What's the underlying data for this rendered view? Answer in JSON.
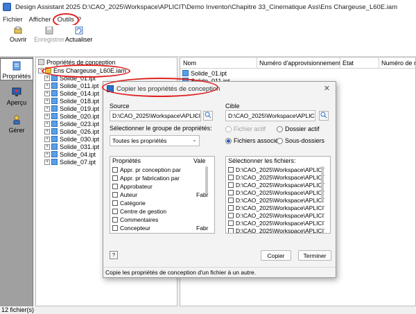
{
  "window": {
    "title": "Design Assistant 2025 D:\\CAO_2025\\Workspace\\APLICIT\\Demo Inventor\\Chapitre 33_Cinematique Ass\\Ens Chargeuse_L60E.iam"
  },
  "menu": {
    "file": "Fichier",
    "view": "Afficher",
    "tools": "Outils",
    "help": "?"
  },
  "toolbar": {
    "open": "Ouvrir",
    "save": "Enregistrer",
    "refresh": "Actualiser"
  },
  "nav": {
    "properties": "Propriétés",
    "preview": "Aperçu",
    "manage": "Gérer"
  },
  "tree": {
    "header": "Propriétés de conception",
    "root": "Ens Chargeuse_L60E.iam",
    "items": [
      "Solide_01.ipt",
      "Solide_011.ipt",
      "Solide_014.ipt",
      "Solide_018.ipt",
      "Solide_019.ipt",
      "Solide_020.ipt",
      "Solide_023.ipt",
      "Solide_026.ipt",
      "Solide_030.ipt",
      "Solide_031.ipt",
      "Solide_04.ipt",
      "Solide_07.ipt"
    ]
  },
  "list": {
    "columns": [
      "Nom",
      "Numéro d'approvisionnement",
      "Etat",
      "Numéro de ré"
    ],
    "rows": [
      "Solide_01.ipt",
      "Solide_011.ipt"
    ]
  },
  "status": {
    "text": "12 fichier(s)"
  },
  "dialog": {
    "title": "Copier les propriétés de conception",
    "close": "✕",
    "source_label": "Source",
    "source_path": "D:\\CAO_2025\\Workspace\\APLICIT",
    "group_label": "Sélectionner le groupe de propriétés:",
    "group_value": "Toutes les propriétés",
    "props_col1": "Propriétés",
    "props_col2": "Vale",
    "properties": [
      {
        "name": "Appr. pr conception par",
        "value": ""
      },
      {
        "name": "Appr. pr fabrication par",
        "value": ""
      },
      {
        "name": "Approbateur",
        "value": ""
      },
      {
        "name": "Auteur",
        "value": "Fabr"
      },
      {
        "name": "Catégorie",
        "value": ""
      },
      {
        "name": "Centre de gestion",
        "value": ""
      },
      {
        "name": "Commentaires",
        "value": ""
      },
      {
        "name": "Concepteur",
        "value": "Fabr"
      }
    ],
    "target_label": "Cible",
    "target_path": "D:\\CAO_2025\\Workspace\\APLICIT",
    "radio_active_file": "Fichier actif",
    "radio_active_folder": "Dossier actif",
    "radio_associated": "Fichiers associés",
    "radio_subfolders": "Sous-dossiers",
    "files_label": "Sélectionner les fichiers:",
    "files": [
      "D:\\CAO_2025\\Workspace\\APLICIT",
      "D:\\CAO_2025\\Workspace\\APLICIT",
      "D:\\CAO_2025\\Workspace\\APLICIT",
      "D:\\CAO_2025\\Workspace\\APLICIT",
      "D:\\CAO_2025\\Workspace\\APLICIT",
      "D:\\CAO_2025\\Workspace\\APLICIT",
      "D:\\CAO_2025\\Workspace\\APLICIT",
      "D:\\CAO_2025\\Workspace\\APLICIT",
      "D:\\CAO_2025\\Workspace\\APLICIT"
    ],
    "copy_button": "Copier",
    "finish_button": "Terminer",
    "status": "Copie les propriétés de conception d'un fichier à un autre.",
    "help": "?"
  },
  "colors": {
    "highlight_oval": "#e02020",
    "accent": "#1e5fc0"
  }
}
